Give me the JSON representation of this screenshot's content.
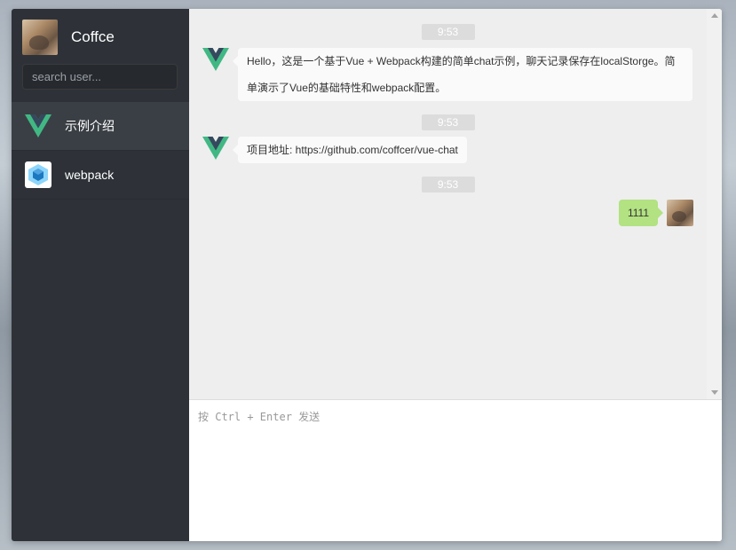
{
  "user": {
    "name": "Coffce",
    "avatar_icon": "user-avatar-photo"
  },
  "search": {
    "placeholder": "search user..."
  },
  "sessions": [
    {
      "name": "示例介绍",
      "icon": "vue-logo-icon",
      "active": true
    },
    {
      "name": "webpack",
      "icon": "webpack-logo-icon",
      "active": false
    }
  ],
  "messages": [
    {
      "time": "9:53",
      "text": "Hello，这是一个基于Vue + Webpack构建的简单chat示例，聊天记录保存在localStorge。简单演示了Vue的基础特性和webpack配置。",
      "self": false
    },
    {
      "time": "9:53",
      "text": "项目地址: https://github.com/coffcer/vue-chat",
      "self": false
    },
    {
      "time": "9:53",
      "text": "1111",
      "self": true
    }
  ],
  "editor": {
    "placeholder": "按 Ctrl + Enter 发送"
  },
  "colors": {
    "sidebar": "#2e3238",
    "active_session": "#3a3f45",
    "chat_bg": "#eeeeee",
    "self_bubble": "#b2e281",
    "vue_green": "#41b883",
    "vue_dark": "#35495e"
  }
}
